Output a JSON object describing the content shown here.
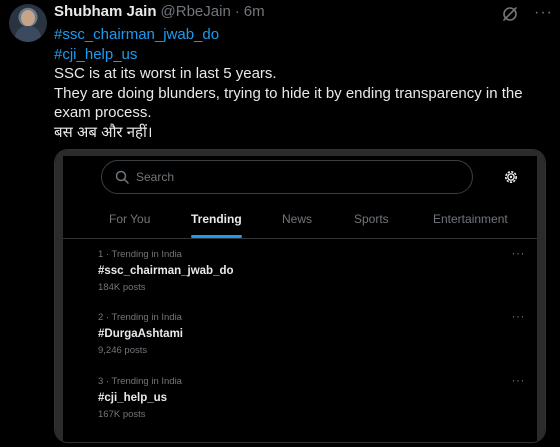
{
  "tweet": {
    "author_name": "Shubham Jain",
    "handle": "@RbeJain",
    "separator": "·",
    "time": "6m",
    "more_label": "···",
    "hashtags": [
      "#ssc_chairman_jwab_do",
      "#cji_help_us"
    ],
    "lines": [
      "SSC is at its worst in last 5 years.",
      "They are doing blunders, trying to hide it by ending transparency in the",
      "exam process.",
      "बस अब और नहीं।"
    ]
  },
  "embedded_screenshot": {
    "search": {
      "placeholder": "Search"
    },
    "tabs": [
      {
        "label": "For You",
        "active": false
      },
      {
        "label": "Trending",
        "active": true
      },
      {
        "label": "News",
        "active": false
      },
      {
        "label": "Sports",
        "active": false
      },
      {
        "label": "Entertainment",
        "active": false
      }
    ],
    "trends": [
      {
        "meta": "1 · Trending in India",
        "topic": "#ssc_chairman_jwab_do",
        "posts": "184K posts"
      },
      {
        "meta": "2 · Trending in India",
        "topic": "#DurgaAshtami",
        "posts": "9,246 posts"
      },
      {
        "meta": "3 · Trending in India",
        "topic": "#cji_help_us",
        "posts": "167K posts"
      }
    ],
    "more_label": "···"
  },
  "colors": {
    "background": "#000000",
    "text": "#e7e9ea",
    "secondary_text": "#71767b",
    "accent": "#1d9bf0",
    "border": "#2f3336"
  }
}
